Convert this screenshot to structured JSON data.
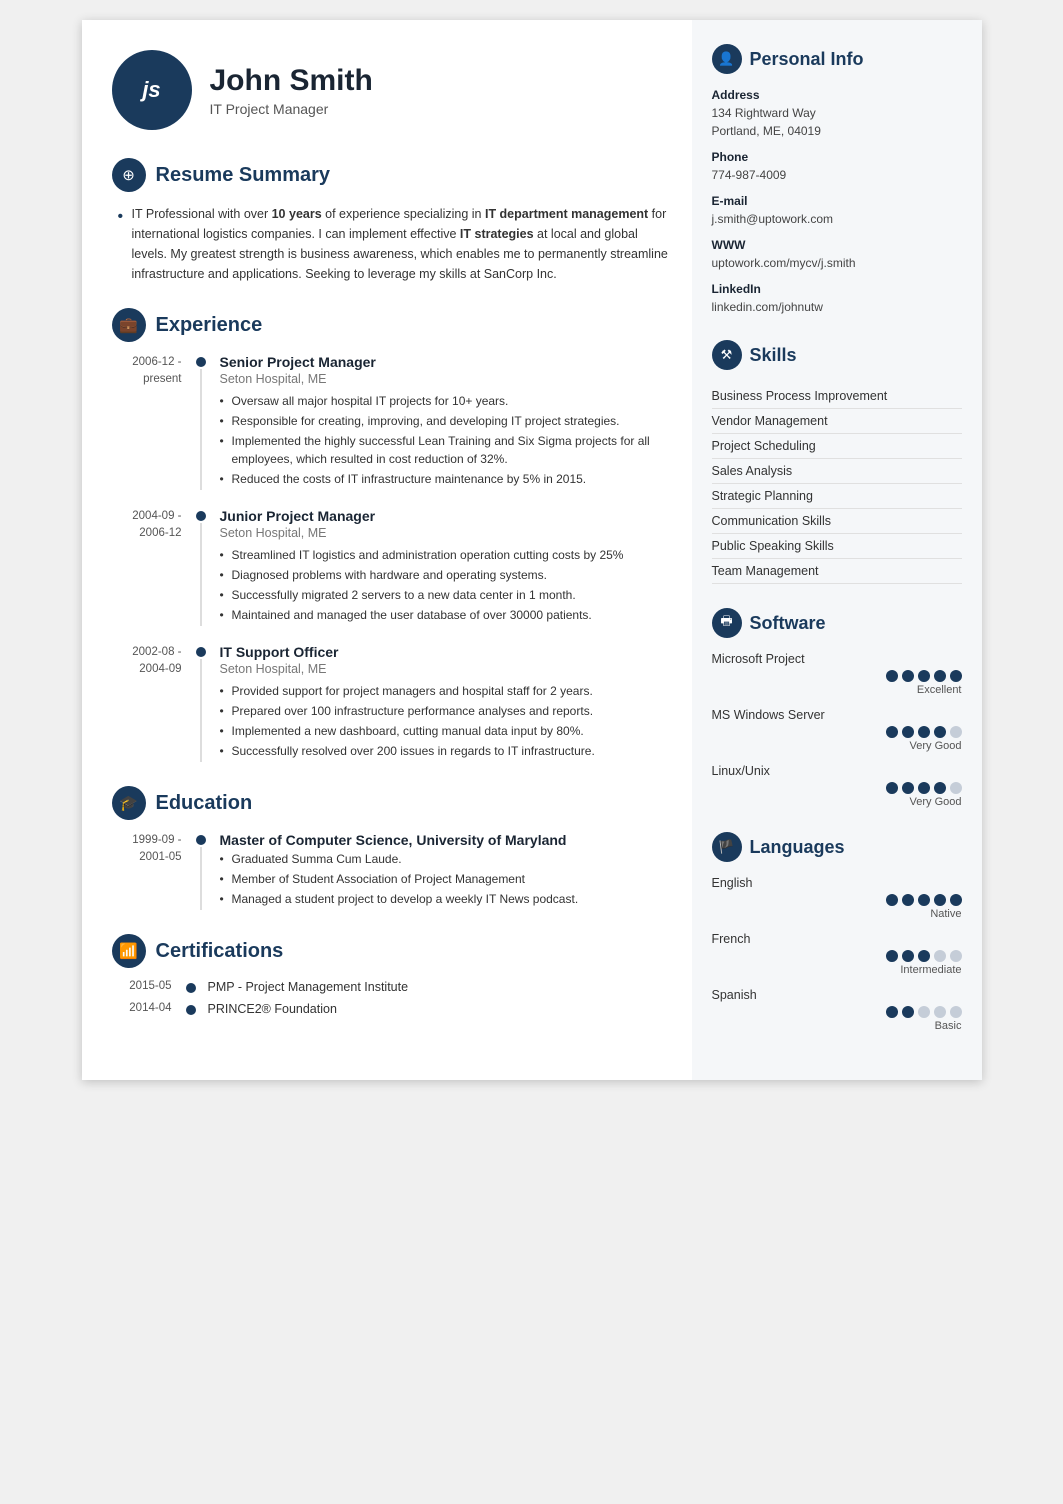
{
  "header": {
    "initials": "js",
    "name": "John Smith",
    "title": "IT Project Manager"
  },
  "summary": {
    "section_title": "Resume Summary",
    "text_parts": [
      {
        "text": "IT Professional with over ",
        "bold": false
      },
      {
        "text": "10 years",
        "bold": true
      },
      {
        "text": " of experience specializing in ",
        "bold": false
      },
      {
        "text": "IT department management",
        "bold": true
      },
      {
        "text": " for international logistics companies. I can implement effective ",
        "bold": false
      },
      {
        "text": "IT strategies",
        "bold": true
      },
      {
        "text": " at local and global levels. My greatest strength is business awareness, which enables me to permanently streamline infrastructure and applications. Seeking to leverage my skills at SanCorp Inc.",
        "bold": false
      }
    ]
  },
  "experience": {
    "section_title": "Experience",
    "entries": [
      {
        "date": "2006-12 - present",
        "title": "Senior Project Manager",
        "org": "Seton Hospital, ME",
        "bullets": [
          "Oversaw all major hospital IT projects for 10+ years.",
          "Responsible for creating, improving, and developing IT project strategies.",
          "Implemented the highly successful Lean Training and Six Sigma projects for all employees, which resulted in cost reduction of 32%.",
          "Reduced the costs of IT infrastructure maintenance by 5% in 2015."
        ]
      },
      {
        "date": "2004-09 - 2006-12",
        "title": "Junior Project Manager",
        "org": "Seton Hospital, ME",
        "bullets": [
          "Streamlined IT logistics and administration operation cutting costs by 25%",
          "Diagnosed problems with hardware and operating systems.",
          "Successfully migrated 2 servers to a new data center in 1 month.",
          "Maintained and managed the user database of over 30000 patients."
        ]
      },
      {
        "date": "2002-08 - 2004-09",
        "title": "IT Support Officer",
        "org": "Seton Hospital, ME",
        "bullets": [
          "Provided support for project managers and hospital staff for 2 years.",
          "Prepared over 100 infrastructure performance analyses and reports.",
          "Implemented a new dashboard, cutting manual data input by 80%.",
          "Successfully resolved over 200 issues in regards to IT infrastructure."
        ]
      }
    ]
  },
  "education": {
    "section_title": "Education",
    "entries": [
      {
        "date": "1999-09 - 2001-05",
        "title": "Master of Computer Science, University of Maryland",
        "bullets": [
          "Graduated Summa Cum Laude.",
          "Member of Student Association of Project Management",
          "Managed a student project to develop a weekly IT News podcast."
        ]
      }
    ]
  },
  "certifications": {
    "section_title": "Certifications",
    "entries": [
      {
        "date": "2015-05",
        "text": "PMP - Project Management Institute"
      },
      {
        "date": "2014-04",
        "text": "PRINCE2® Foundation"
      }
    ]
  },
  "personal_info": {
    "section_title": "Personal Info",
    "address_label": "Address",
    "address": "134 Rightward Way\nPortland, ME, 04019",
    "phone_label": "Phone",
    "phone": "774-987-4009",
    "email_label": "E-mail",
    "email": "j.smith@uptowork.com",
    "www_label": "WWW",
    "www": "uptowork.com/mycv/j.smith",
    "linkedin_label": "LinkedIn",
    "linkedin": "linkedin.com/johnutw"
  },
  "skills": {
    "section_title": "Skills",
    "items": [
      "Business Process Improvement",
      "Vendor Management",
      "Project Scheduling",
      "Sales Analysis",
      "Strategic Planning",
      "Communication Skills",
      "Public Speaking Skills",
      "Team Management"
    ]
  },
  "software": {
    "section_title": "Software",
    "items": [
      {
        "name": "Microsoft Project",
        "filled": 5,
        "total": 5,
        "label": "Excellent"
      },
      {
        "name": "MS Windows Server",
        "filled": 4,
        "total": 5,
        "label": "Very Good"
      },
      {
        "name": "Linux/Unix",
        "filled": 4,
        "total": 5,
        "label": "Very Good"
      }
    ]
  },
  "languages": {
    "section_title": "Languages",
    "items": [
      {
        "name": "English",
        "filled": 5,
        "total": 5,
        "label": "Native"
      },
      {
        "name": "French",
        "filled": 3,
        "total": 5,
        "label": "Intermediate"
      },
      {
        "name": "Spanish",
        "filled": 2,
        "total": 5,
        "label": "Basic"
      }
    ]
  }
}
